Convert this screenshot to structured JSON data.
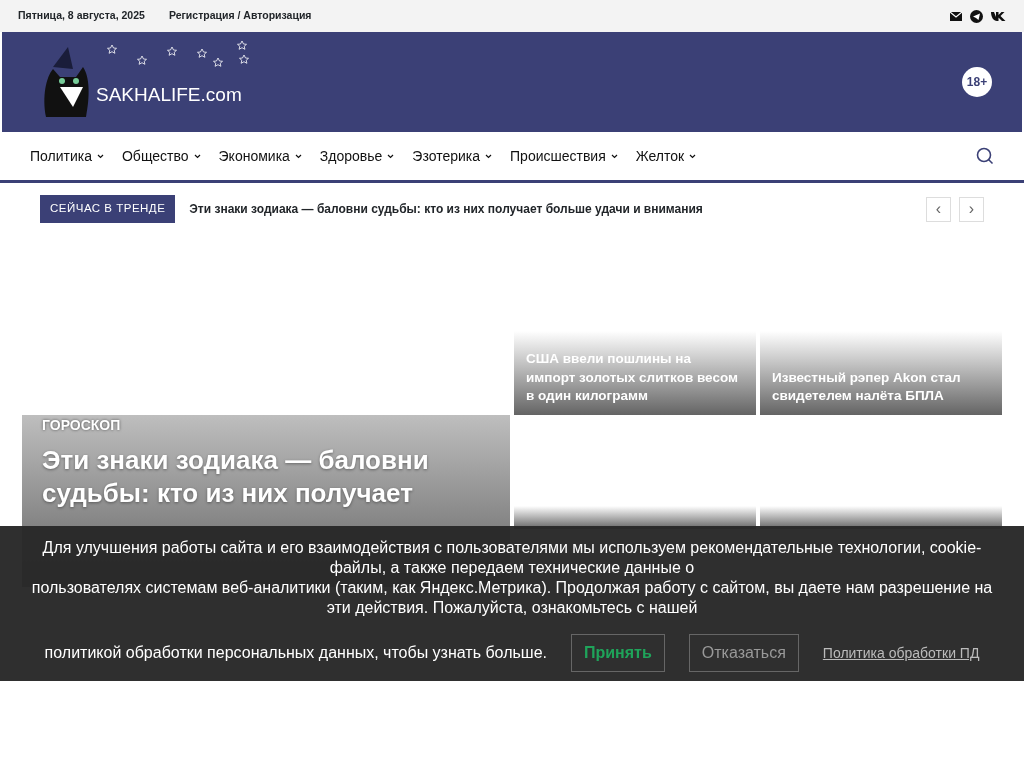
{
  "top_bar": {
    "date": "Пятница, 8 августа, 2025",
    "auth_link": "Регистрация / Авторизация"
  },
  "header": {
    "logo_text": "SAKHALIFE.com",
    "age_badge": "18+"
  },
  "nav": {
    "items": [
      {
        "label": "Политика"
      },
      {
        "label": "Общество"
      },
      {
        "label": "Экономика"
      },
      {
        "label": "Здоровье"
      },
      {
        "label": "Эзотерика"
      },
      {
        "label": "Происшествия"
      },
      {
        "label": "Желток"
      }
    ]
  },
  "trending": {
    "label": "СЕЙЧАС В ТРЕНДЕ",
    "headline": "Эти знаки зодиака — баловни судьбы: кто из них получает больше удачи и внимания",
    "prev": "‹",
    "next": "›"
  },
  "featured": {
    "category": "ГОРОСКОП",
    "title": "Эти знаки зодиака — баловни судьбы: кто из них получает"
  },
  "tiles": [
    {
      "kind": "titled",
      "title": "США ввели пошлины на импорт золотых слитков весом в один килограмм"
    },
    {
      "kind": "titled",
      "title": "Известный рэпер Akon стал свидетелем налёта БПЛА"
    },
    {
      "kind": "covered"
    },
    {
      "kind": "covered"
    }
  ],
  "cookie_banner": {
    "lines": [
      "Для улучшения работы сайта и его взаимодействия с пользователями мы используем рекомендательные технологии, cookie-файлы, а также передаем технические данные о",
      "пользователях системам веб-аналитики (таким, как Яндекс.Метрика). Продолжая работу с сайтом, вы даете нам разрешение на эти действия. Пожалуйста, ознакомьтесь с нашей"
    ],
    "last_line": "политикой обработки персональных данных, чтобы узнать больше.",
    "accept": "Принять",
    "decline": "Отказаться",
    "policy_link": "Политика обработки ПД"
  }
}
